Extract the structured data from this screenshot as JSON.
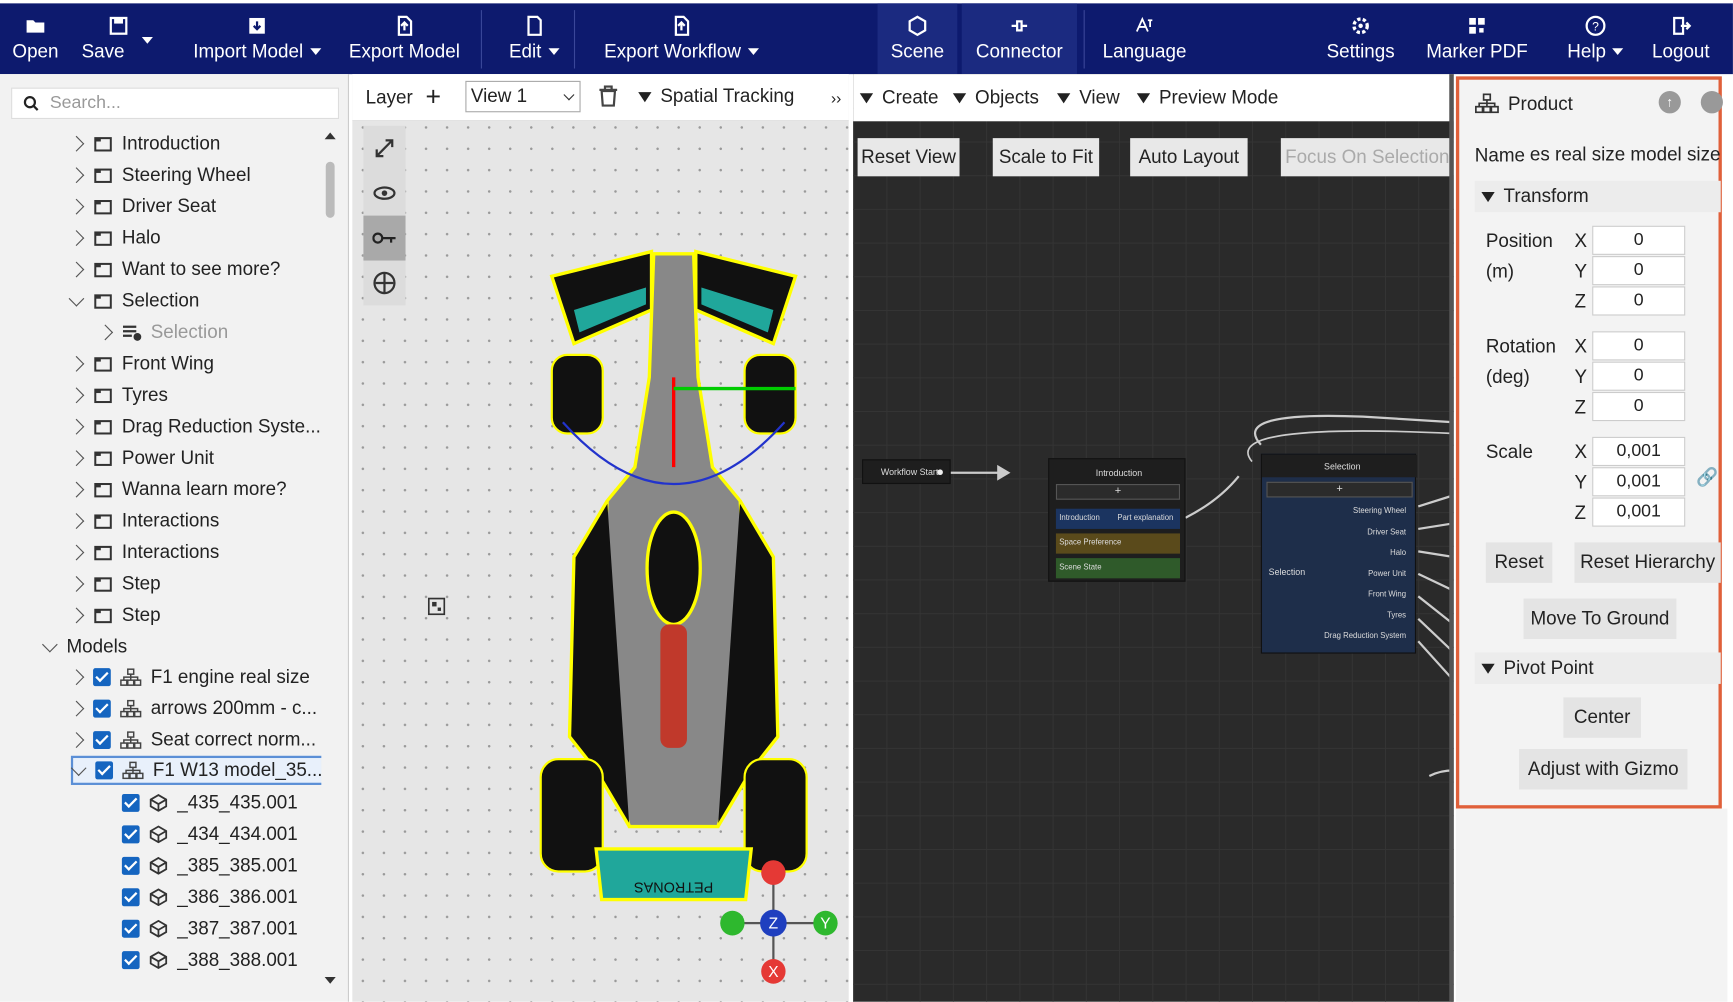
{
  "toolbar": {
    "open": "Open",
    "save": "Save",
    "import_model": "Import Model",
    "export_model": "Export Model",
    "edit": "Edit",
    "export_workflow": "Export Workflow",
    "scene": "Scene",
    "connector": "Connector",
    "language": "Language",
    "settings": "Settings",
    "marker_pdf": "Marker PDF",
    "help": "Help",
    "logout": "Logout"
  },
  "left_panel": {
    "search_placeholder": "Search...",
    "tree": [
      {
        "label": "Introduction"
      },
      {
        "label": "Steering Wheel"
      },
      {
        "label": "Driver Seat"
      },
      {
        "label": "Halo"
      },
      {
        "label": "Want to see more?"
      },
      {
        "label": "Selection"
      },
      {
        "label": "Selection"
      },
      {
        "label": "Front Wing"
      },
      {
        "label": "Tyres"
      },
      {
        "label": "Drag Reduction Syste..."
      },
      {
        "label": "Power Unit"
      },
      {
        "label": "Wanna learn more?"
      },
      {
        "label": "Interactions"
      },
      {
        "label": "Interactions"
      },
      {
        "label": "Step"
      },
      {
        "label": "Step"
      }
    ],
    "models_label": "Models",
    "models": [
      {
        "label": "F1 engine real size"
      },
      {
        "label": "arrows 200mm - c..."
      },
      {
        "label": "Seat correct norm..."
      },
      {
        "label": "F1 W13 model_35..."
      }
    ],
    "meshes": [
      {
        "label": "_435_435.001"
      },
      {
        "label": "_434_434.001"
      },
      {
        "label": "_385_385.001"
      },
      {
        "label": "_386_386.001"
      },
      {
        "label": "_387_387.001"
      },
      {
        "label": "_388_388.001"
      }
    ]
  },
  "viewport": {
    "layer_label": "Layer",
    "view_select": "View 1",
    "spatial_tracking": "Spatial Tracking",
    "wing_text": "PETRONAS",
    "axis_z": "Z",
    "axis_y": "Y",
    "axis_x": "X"
  },
  "graph": {
    "menu": {
      "create": "Create",
      "objects": "Objects",
      "view": "View",
      "preview_mode": "Preview Mode"
    },
    "buttons": {
      "reset_view": "Reset View",
      "scale_to_fit": "Scale to Fit",
      "auto_layout": "Auto Layout",
      "focus_on_selection": "Focus On Selection"
    },
    "nodes": {
      "workflow_start": "Workflow Start",
      "intro_title": "Introduction",
      "intro_rows": [
        "Introduction",
        "Part explanation",
        "Space Preference",
        "Scene State"
      ],
      "selection_title": "Selection",
      "selection_left": "Selection",
      "selection_rows": [
        "Steering Wheel",
        "Driver Seat",
        "Halo",
        "Power Unit",
        "Front Wing",
        "Tyres",
        "Drag Reduction System"
      ]
    }
  },
  "properties": {
    "title": "Product",
    "name_label": "Name",
    "name_value": "gles real size model size",
    "transform": "Transform",
    "position_label": "Position",
    "position_unit": "(m)",
    "position": {
      "x": "0",
      "y": "0",
      "z": "0"
    },
    "rotation_label": "Rotation",
    "rotation_unit": "(deg)",
    "rotation": {
      "x": "0",
      "y": "0",
      "z": "0"
    },
    "scale_label": "Scale",
    "scale": {
      "x": "0,001",
      "y": "0,001",
      "z": "0,001"
    },
    "x": "X",
    "y": "Y",
    "z": "Z",
    "reset": "Reset",
    "reset_hierarchy": "Reset Hierarchy",
    "move_to_ground": "Move To Ground",
    "pivot_point": "Pivot Point",
    "center": "Center",
    "adjust_with_gizmo": "Adjust with Gizmo"
  }
}
